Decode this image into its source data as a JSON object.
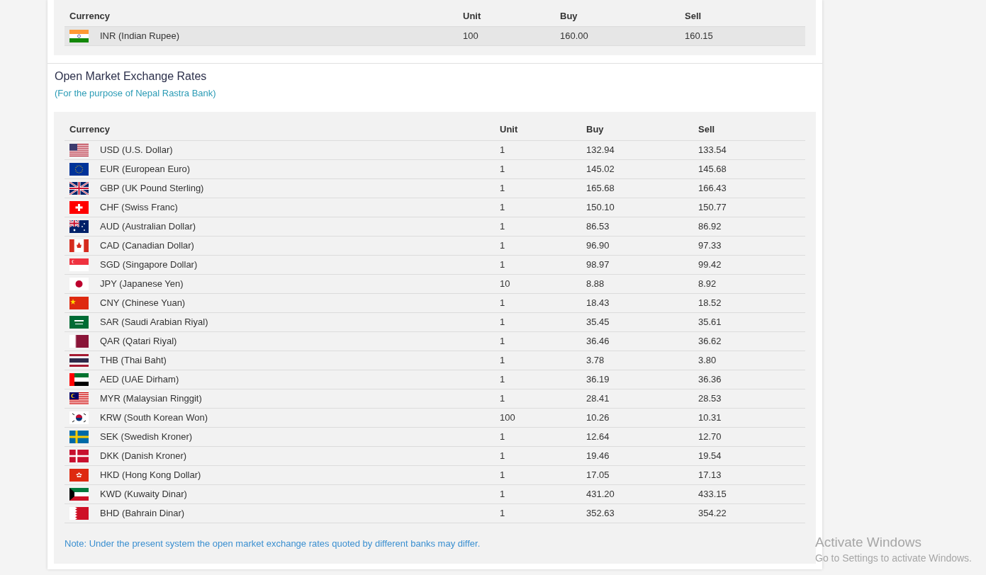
{
  "top_table": {
    "columns": [
      "Currency",
      "Unit",
      "Buy",
      "Sell"
    ],
    "rows": [
      {
        "currency": "INR (Indian Rupee)",
        "unit": "100",
        "buy": "160.00",
        "sell": "160.15",
        "selected": true
      }
    ]
  },
  "open_market": {
    "title": "Open Market Exchange Rates",
    "subtitle": "(For the purpose of Nepal Rastra Bank)",
    "columns": [
      "Currency",
      "Unit",
      "Buy",
      "Sell"
    ],
    "rows": [
      {
        "currency": "USD (U.S. Dollar)",
        "unit": "1",
        "buy": "132.94",
        "sell": "133.54"
      },
      {
        "currency": "EUR (European Euro)",
        "unit": "1",
        "buy": "145.02",
        "sell": "145.68"
      },
      {
        "currency": "GBP (UK Pound Sterling)",
        "unit": "1",
        "buy": "165.68",
        "sell": "166.43"
      },
      {
        "currency": "CHF (Swiss Franc)",
        "unit": "1",
        "buy": "150.10",
        "sell": "150.77"
      },
      {
        "currency": "AUD (Australian Dollar)",
        "unit": "1",
        "buy": "86.53",
        "sell": "86.92"
      },
      {
        "currency": "CAD (Canadian Dollar)",
        "unit": "1",
        "buy": "96.90",
        "sell": "97.33"
      },
      {
        "currency": "SGD (Singapore Dollar)",
        "unit": "1",
        "buy": "98.97",
        "sell": "99.42"
      },
      {
        "currency": "JPY (Japanese Yen)",
        "unit": "10",
        "buy": "8.88",
        "sell": "8.92"
      },
      {
        "currency": "CNY (Chinese Yuan)",
        "unit": "1",
        "buy": "18.43",
        "sell": "18.52"
      },
      {
        "currency": "SAR (Saudi Arabian Riyal)",
        "unit": "1",
        "buy": "35.45",
        "sell": "35.61"
      },
      {
        "currency": "QAR (Qatari Riyal)",
        "unit": "1",
        "buy": "36.46",
        "sell": "36.62"
      },
      {
        "currency": "THB (Thai Baht)",
        "unit": "1",
        "buy": "3.78",
        "sell": "3.80"
      },
      {
        "currency": "AED (UAE Dirham)",
        "unit": "1",
        "buy": "36.19",
        "sell": "36.36"
      },
      {
        "currency": "MYR (Malaysian Ringgit)",
        "unit": "1",
        "buy": "28.41",
        "sell": "28.53"
      },
      {
        "currency": "KRW (South Korean Won)",
        "unit": "100",
        "buy": "10.26",
        "sell": "10.31"
      },
      {
        "currency": "SEK (Swedish Kroner)",
        "unit": "1",
        "buy": "12.64",
        "sell": "12.70"
      },
      {
        "currency": "DKK (Danish Kroner)",
        "unit": "1",
        "buy": "19.46",
        "sell": "19.54"
      },
      {
        "currency": "HKD (Hong Kong Dollar)",
        "unit": "1",
        "buy": "17.05",
        "sell": "17.13"
      },
      {
        "currency": "KWD (Kuwaity Dinar)",
        "unit": "1",
        "buy": "431.20",
        "sell": "433.15"
      },
      {
        "currency": "BHD (Bahrain Dinar)",
        "unit": "1",
        "buy": "352.63",
        "sell": "354.22"
      }
    ],
    "note": "Note: Under the present system the open market exchange rates quoted by different banks may differ."
  },
  "os_overlay": {
    "title": "Activate Windows",
    "message": "Go to Settings to activate Windows."
  }
}
